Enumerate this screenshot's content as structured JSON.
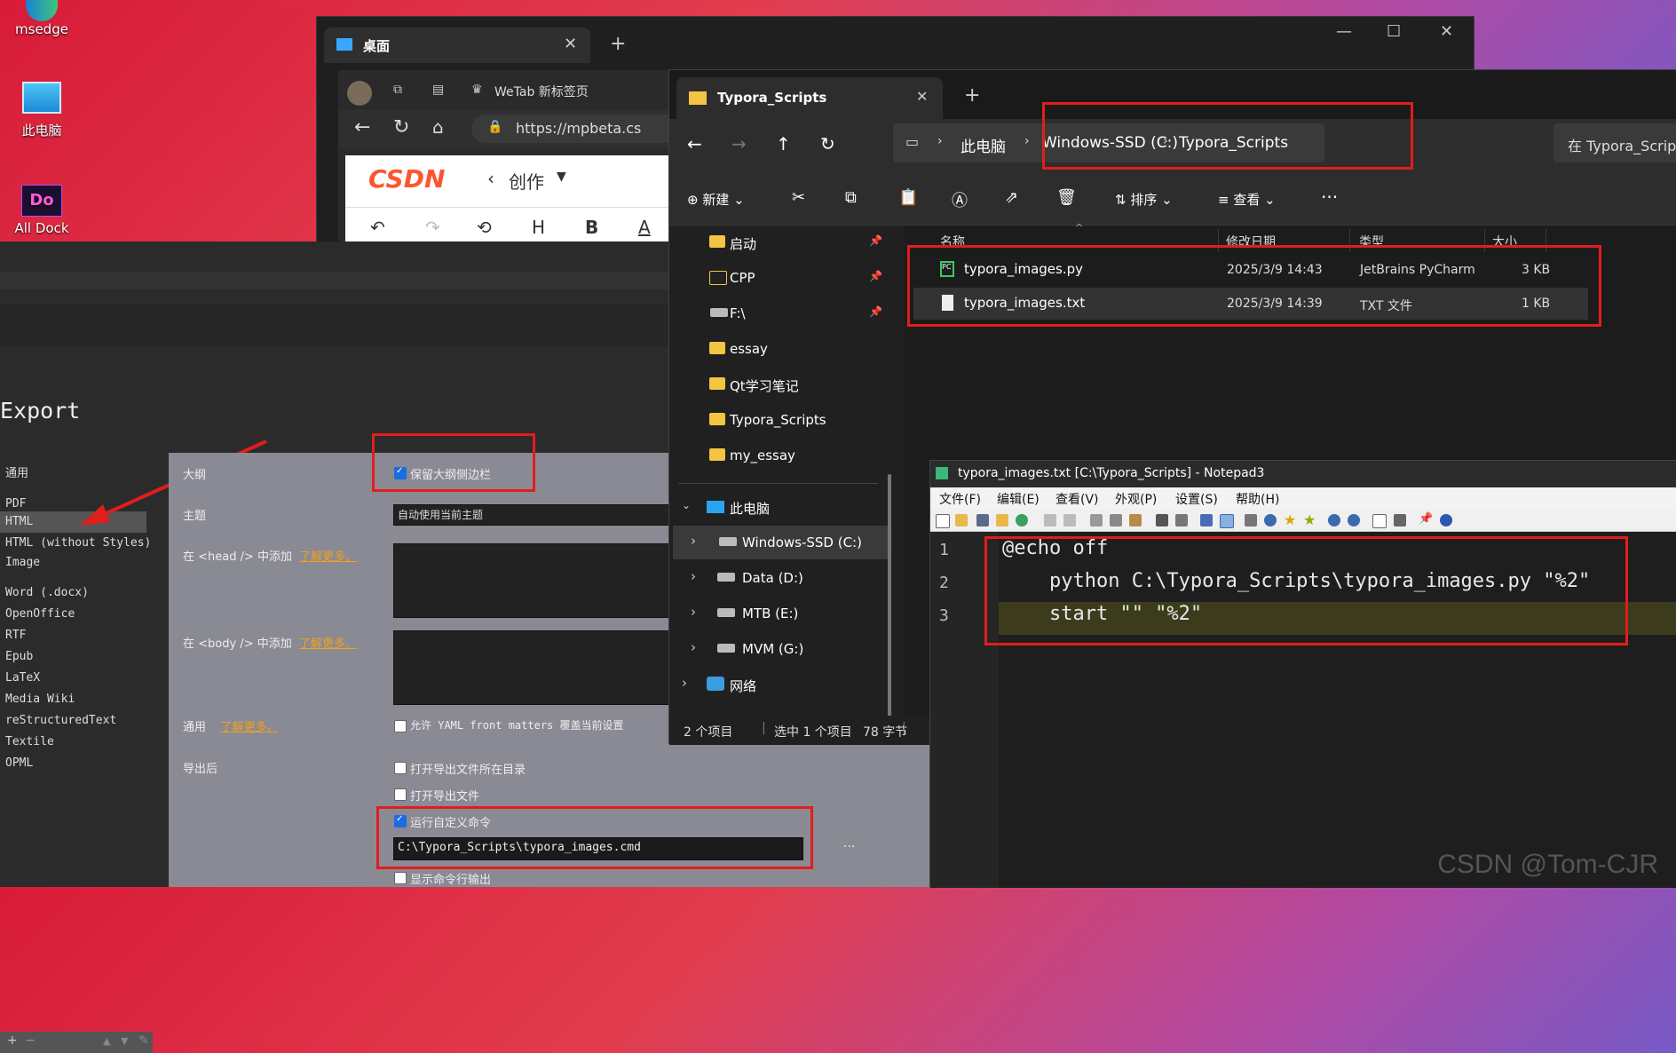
{
  "desktop": {
    "icons": [
      {
        "label": "msedge"
      },
      {
        "label": "此电脑"
      },
      {
        "label": "All Dock"
      }
    ]
  },
  "edge": {
    "tab_title": "桌面",
    "tab2_title": "WeTab 新标签页",
    "address": "https://mpbeta.cs",
    "csdn_logo": "CSDN",
    "create_label": "创作"
  },
  "typora": {
    "heading": "Export",
    "sidebar": [
      {
        "label": "通用"
      },
      {
        "label": "PDF"
      },
      {
        "label": "HTML"
      },
      {
        "label": "HTML (without Styles)"
      },
      {
        "label": "Image"
      },
      {
        "label": "Word (.docx)"
      },
      {
        "label": "OpenOffice"
      },
      {
        "label": "RTF"
      },
      {
        "label": "Epub"
      },
      {
        "label": "LaTeX"
      },
      {
        "label": "Media Wiki"
      },
      {
        "label": "reStructuredText"
      },
      {
        "label": "Textile"
      },
      {
        "label": "OPML"
      }
    ],
    "settings": {
      "outline_label": "大纲",
      "outline_checkbox": "保留大纲侧边栏",
      "theme_label": "主题",
      "theme_value": "自动使用当前主题",
      "head_label": "在 <head /> 中添加",
      "body_label": "在 <body /> 中添加",
      "learn_more": "了解更多。",
      "general_label": "通用",
      "yaml_checkbox": "允许 YAML front matters 覆盖当前设置",
      "after_export_label": "导出后",
      "open_dir_checkbox": "打开导出文件所在目录",
      "open_file_checkbox": "打开导出文件",
      "run_cmd_checkbox": "运行自定义命令",
      "cmd_value": "C:\\Typora_Scripts\\typora_images.cmd",
      "show_output_checkbox": "显示命令行输出",
      "more_btn": "···"
    }
  },
  "explorer": {
    "tab_title": "Typora_Scripts",
    "breadcrumb": [
      "此电脑",
      "Windows-SSD (C:)",
      "Typora_Scripts"
    ],
    "search_placeholder": "在 Typora_Scrip",
    "toolbar": {
      "new": "新建",
      "sort": "排序",
      "view": "查看"
    },
    "tree": [
      {
        "label": "启动",
        "type": "folder",
        "pinned": true
      },
      {
        "label": "CPP",
        "type": "folder",
        "pinned": true
      },
      {
        "label": "F:\\",
        "type": "drive",
        "pinned": true
      },
      {
        "label": "essay",
        "type": "folder",
        "pinned": false
      },
      {
        "label": "Qt学习笔记",
        "type": "folder",
        "pinned": false
      },
      {
        "label": "Typora_Scripts",
        "type": "folder",
        "pinned": false
      },
      {
        "label": "my_essay",
        "type": "folder",
        "pinned": false
      }
    ],
    "thispc": "此电脑",
    "drives": [
      {
        "label": "Windows-SSD (C:)"
      },
      {
        "label": "Data (D:)"
      },
      {
        "label": "MTB (E:)"
      },
      {
        "label": "MVM (G:)"
      }
    ],
    "network": "网络",
    "columns": [
      "名称",
      "修改日期",
      "类型",
      "大小"
    ],
    "files": [
      {
        "name": "typora_images.py",
        "date": "2025/3/9 14:43",
        "type": "JetBrains PyCharm",
        "size": "3 KB"
      },
      {
        "name": "typora_images.txt",
        "date": "2025/3/9 14:39",
        "type": "TXT 文件",
        "size": "1 KB"
      }
    ],
    "status": {
      "count": "2 个项目",
      "selected": "选中 1 个项目",
      "bytes": "78 字节"
    }
  },
  "notepad": {
    "title": "typora_images.txt [C:\\Typora_Scripts] - Notepad3",
    "menu": [
      "文件(F)",
      "编辑(E)",
      "查看(V)",
      "外观(P)",
      "设置(S)",
      "帮助(H)"
    ],
    "lines": [
      {
        "num": "1",
        "code": "@echo off"
      },
      {
        "num": "2",
        "code": "    python C:\\Typora_Scripts\\typora_images.py \"%2\""
      },
      {
        "num": "3",
        "code": "    start \"\" \"%2\""
      }
    ]
  },
  "watermark": "CSDN @Tom-CJR"
}
